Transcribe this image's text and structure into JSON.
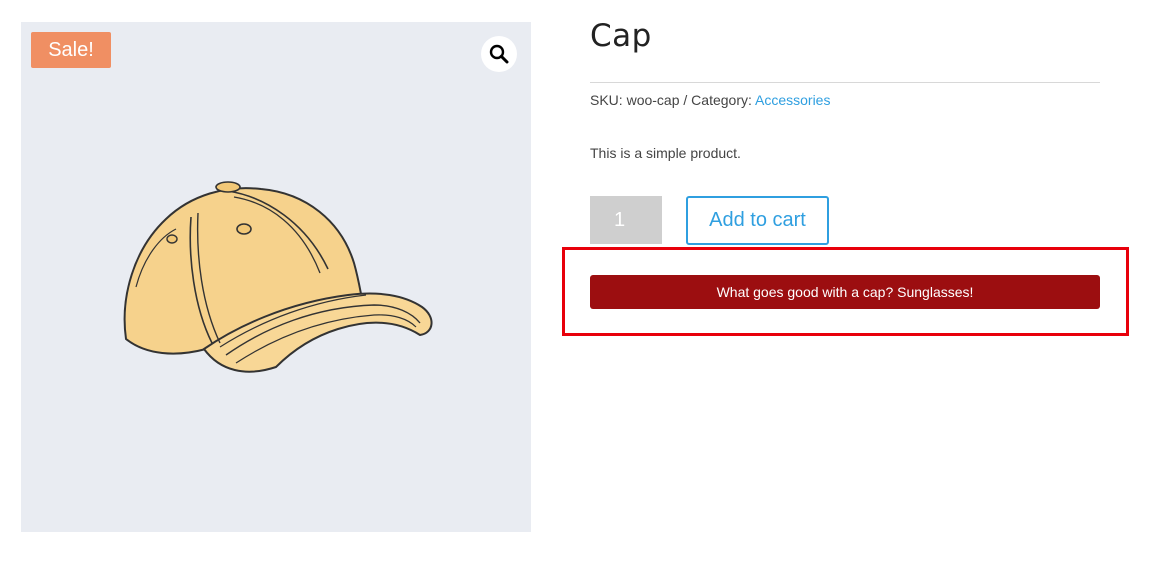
{
  "gallery": {
    "sale_badge": "Sale!",
    "zoom_icon": "magnifier-icon",
    "image_subject": "cap-image",
    "background_color": "#e9ecf2",
    "badge_color": "#f08f63"
  },
  "product": {
    "title": "Cap",
    "sku_label": "SKU:",
    "sku_value": "woo-cap",
    "meta_separator": "/",
    "category_label": "Category:",
    "category_link": "Accessories",
    "short_description": "This is a simple product.",
    "quantity": "1",
    "add_to_cart_label": "Add to cart",
    "accent_color": "#2f9fe0"
  },
  "promo": {
    "button_label": "What goes good with a cap? Sunglasses!",
    "button_color": "#9c0e10",
    "highlight_color": "#e8000b"
  }
}
